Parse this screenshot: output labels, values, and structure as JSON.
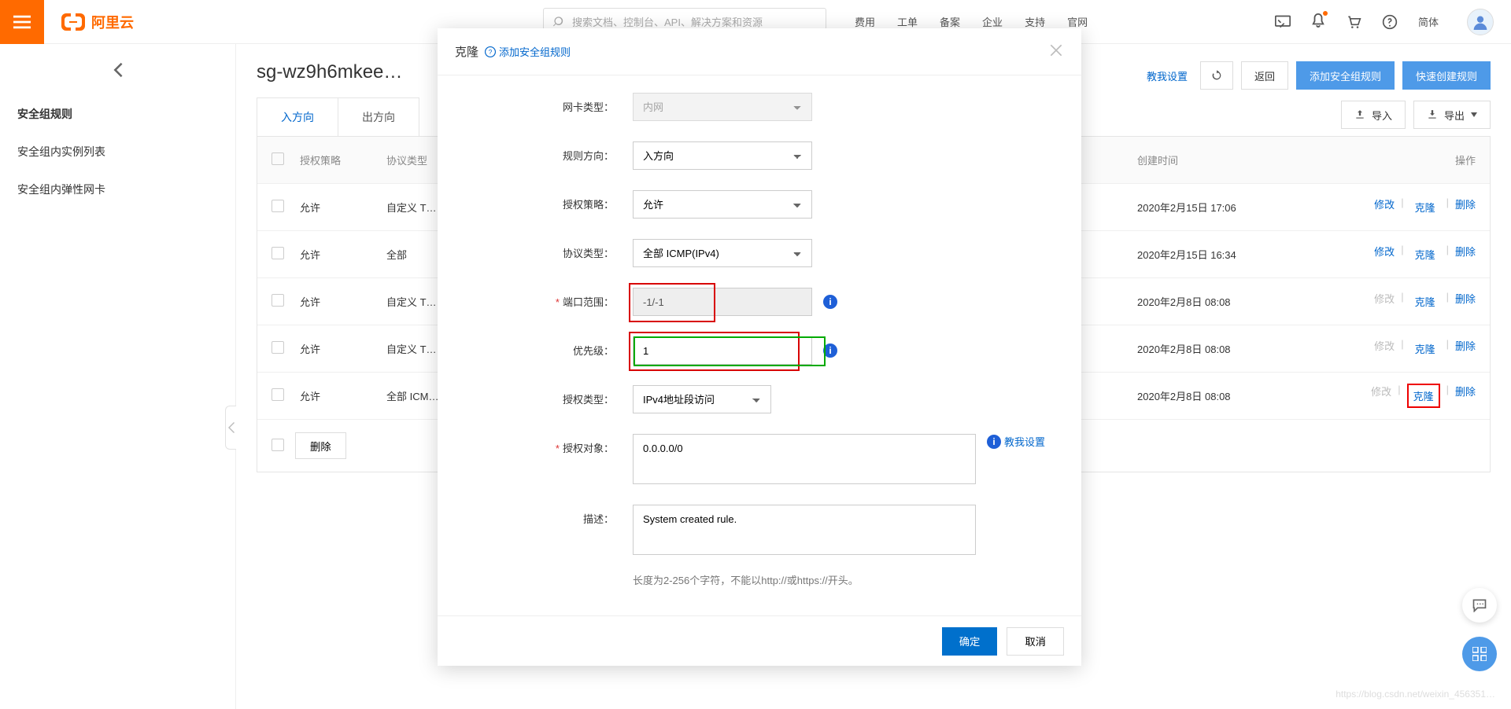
{
  "top": {
    "brand": "阿里云",
    "search_placeholder": "搜索文档、控制台、API、解决方案和资源",
    "nav": [
      "费用",
      "工单",
      "备案",
      "企业",
      "支持",
      "官网"
    ],
    "lang": "简体"
  },
  "side": {
    "items": [
      "安全组规则",
      "安全组内实例列表",
      "安全组内弹性网卡"
    ]
  },
  "page": {
    "title": "sg-wz9h6mkee…",
    "actions": {
      "teach": "教我设置",
      "back": "返回",
      "add": "添加安全组规则",
      "quick": "快速创建规则",
      "import": "导入",
      "export": "导出"
    },
    "tabs": {
      "in": "入方向",
      "out": "出方向"
    },
    "table_head": {
      "auth": "授权策略",
      "proto": "协议类型",
      "created": "创建时间",
      "ops": "操作"
    },
    "ops": {
      "mod": "修改",
      "clone": "克隆",
      "del": "删除"
    },
    "rows": [
      {
        "auth": "允许",
        "proto": "自定义 T…",
        "created": "2020年2月15日 17:06",
        "mod_disabled": false
      },
      {
        "auth": "允许",
        "proto": "全部",
        "created": "2020年2月15日 16:34",
        "mod_disabled": false
      },
      {
        "auth": "允许",
        "proto": "自定义 T…",
        "created": "2020年2月8日 08:08",
        "mod_disabled": true
      },
      {
        "auth": "允许",
        "proto": "自定义 T…",
        "created": "2020年2月8日 08:08",
        "mod_disabled": true
      },
      {
        "auth": "允许",
        "proto": "全部 ICM…",
        "created": "2020年2月8日 08:08",
        "mod_disabled": true,
        "highlight_clone": true
      }
    ],
    "batch_del": "删除"
  },
  "modal": {
    "title": "克隆",
    "help": "添加安全组规则",
    "labels": {
      "nic": "网卡类型：",
      "dir": "规则方向：",
      "auth": "授权策略：",
      "proto": "协议类型：",
      "port": "端口范围：",
      "priority": "优先级：",
      "auth_type": "授权类型：",
      "auth_obj": "授权对象：",
      "desc": "描述："
    },
    "values": {
      "nic": "内网",
      "dir": "入方向",
      "auth": "允许",
      "proto": "全部 ICMP(IPv4)",
      "port": "-1/-1",
      "priority": "1",
      "auth_type": "IPv4地址段访问",
      "auth_obj": "0.0.0.0/0",
      "desc": "System created rule."
    },
    "teach": "教我设置",
    "desc_hint": "长度为2-256个字符，不能以http://或https://开头。",
    "ok": "确定",
    "cancel": "取消"
  },
  "watermark": "https://blog.csdn.net/weixin_456351…"
}
